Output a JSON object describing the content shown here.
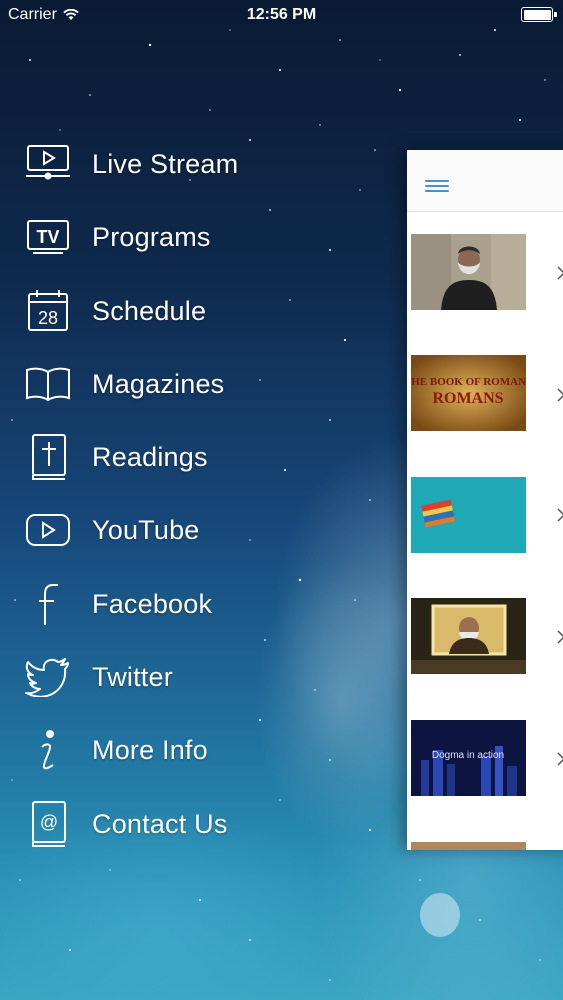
{
  "status_bar": {
    "carrier": "Carrier",
    "time": "12:56 PM",
    "icons": [
      "wifi-icon",
      "battery-icon"
    ]
  },
  "menu": {
    "items": [
      {
        "label": "Live Stream",
        "icon": "live-stream-icon"
      },
      {
        "label": "Programs",
        "icon": "tv-icon"
      },
      {
        "label": "Schedule",
        "icon": "calendar-icon"
      },
      {
        "label": "Magazines",
        "icon": "book-icon"
      },
      {
        "label": "Readings",
        "icon": "bible-icon"
      },
      {
        "label": "YouTube",
        "icon": "youtube-icon"
      },
      {
        "label": "Facebook",
        "icon": "facebook-icon"
      },
      {
        "label": "Twitter",
        "icon": "twitter-icon"
      },
      {
        "label": "More Info",
        "icon": "info-icon"
      },
      {
        "label": "Contact Us",
        "icon": "contact-icon"
      }
    ],
    "calendar_day": "28",
    "tv_text": "TV"
  },
  "panel": {
    "menu_icon": "hamburger-icon",
    "thumbnails": [
      {
        "caption": ""
      },
      {
        "caption": "THE BOOK OF ROMANS"
      },
      {
        "caption": ""
      },
      {
        "caption": ""
      },
      {
        "caption": "Dogma in action"
      },
      {
        "caption": ""
      }
    ]
  },
  "colors": {
    "accent": "#4a90c8",
    "menu_text": "#ffffff",
    "panel_bg": "#ffffff"
  }
}
